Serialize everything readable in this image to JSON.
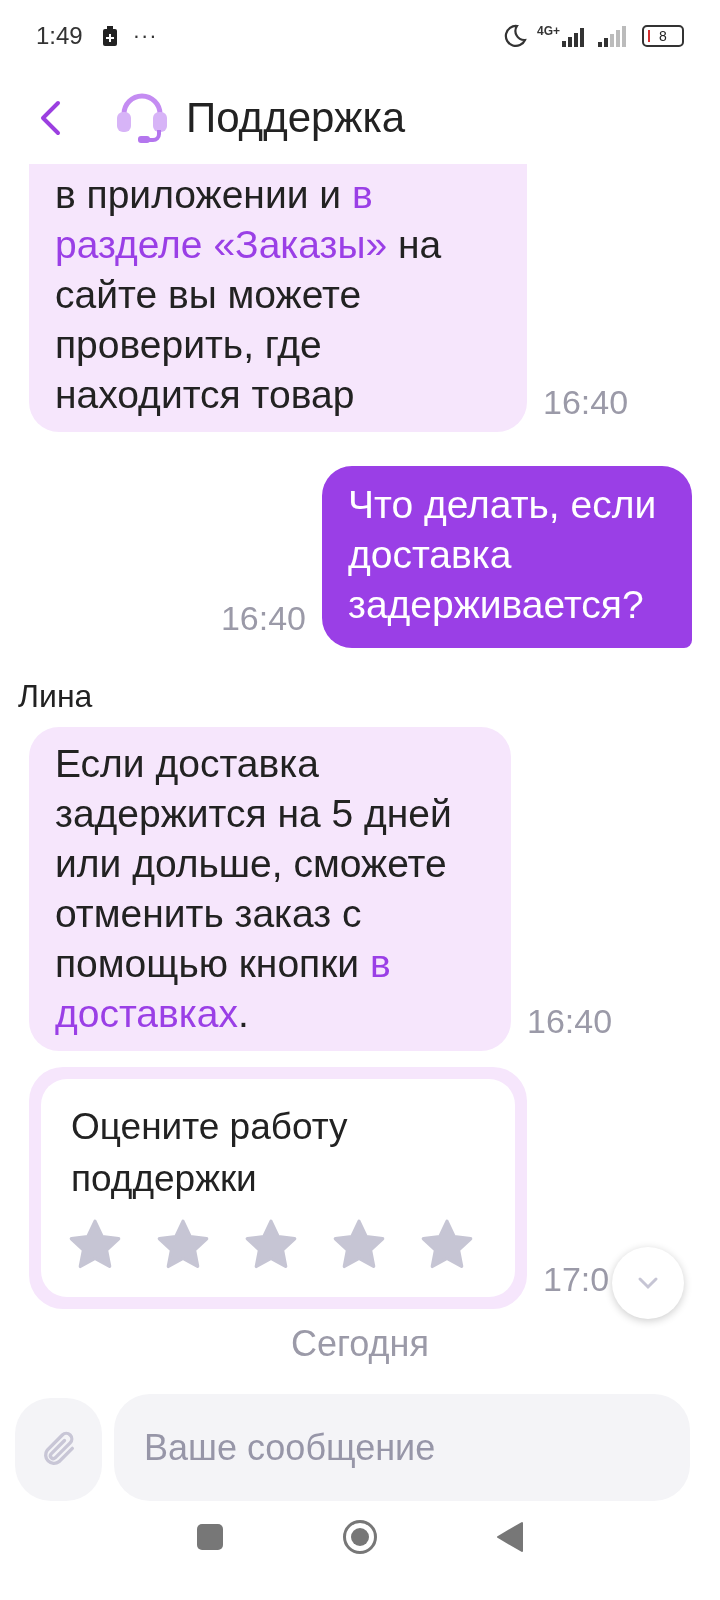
{
  "status_bar": {
    "time": "1:49",
    "more": "···",
    "network": "4G+",
    "battery": "8"
  },
  "header": {
    "title": "Поддержка"
  },
  "messages": [
    {
      "kind": "incoming",
      "segments": [
        {
          "kind": "text",
          "text": "в приложении и "
        },
        {
          "kind": "link",
          "text": "в"
        },
        {
          "kind": "link",
          "text": "разделе «Заказы»"
        },
        {
          "kind": "text",
          "text": " на сайте вы можете проверить, где находится товар"
        }
      ],
      "time": "16:40",
      "cut_top": true
    },
    {
      "kind": "outgoing",
      "segments": [
        {
          "kind": "text",
          "text": "Что делать, если доставка задерживается?"
        }
      ],
      "time": "16:40",
      "cut_top": false
    },
    {
      "kind": "incoming",
      "sender": "Лина",
      "segments": [
        {
          "kind": "text",
          "text": "Если доставка задержится на 5 дней или дольше, сможете отменить заказ с помощью кнопки "
        },
        {
          "kind": "link",
          "text": "в"
        },
        {
          "kind": "link",
          "text": "доставках"
        },
        {
          "kind": "text",
          "text": "."
        }
      ],
      "time": "16:40",
      "cut_top": false
    }
  ],
  "rating": {
    "title": "Оцените работу поддержки",
    "stars": 0,
    "time": "17:0"
  },
  "date_divider": "Сегодня",
  "composer": {
    "placeholder": "Ваше сообщение"
  }
}
